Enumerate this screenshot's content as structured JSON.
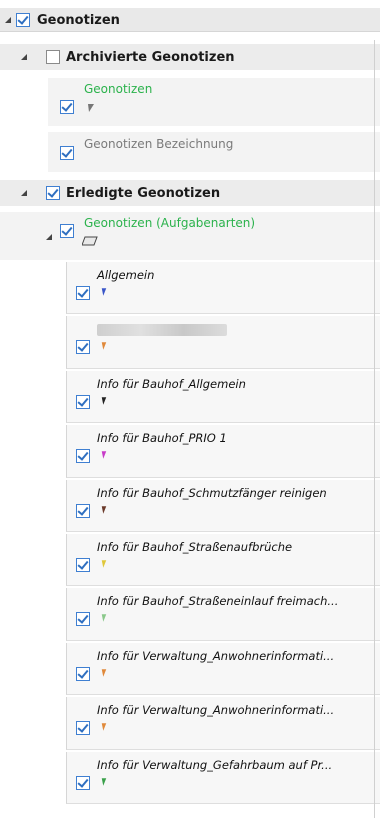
{
  "tree": {
    "root": {
      "label": "Geonotizen"
    },
    "archived": {
      "label": "Archivierte Geonotizen"
    },
    "archived_children": [
      {
        "label": "Geonotizen"
      },
      {
        "label": "Geonotizen Bezeichnung"
      }
    ],
    "done": {
      "label": "Erledigte Geonotizen"
    },
    "done_group": {
      "label": "Geonotizen (Aufgabenarten)"
    },
    "items": [
      {
        "label": "Allgemein",
        "color": "#3a56c8"
      },
      {
        "label": "",
        "color": "#e0893a"
      },
      {
        "label": "Info für Bauhof_Allgemein",
        "color": "#222222"
      },
      {
        "label": "Info für Bauhof_PRIO 1",
        "color": "#c83ac8"
      },
      {
        "label": "Info für Bauhof_Schmutzfänger reinigen",
        "color": "#6b3a2a"
      },
      {
        "label": "Info für Bauhof_Straßenaufbrüche",
        "color": "#e0c83a"
      },
      {
        "label": "Info für Bauhof_Straßeneinlauf freimach...",
        "color": "#8ac88a"
      },
      {
        "label": "Info für Verwaltung_Anwohnerinformati...",
        "color": "#e0893a"
      },
      {
        "label": "Info für Verwaltung_Anwohnerinformati...",
        "color": "#e0893a"
      },
      {
        "label": "Info für Verwaltung_Gefahrbaum auf Pr...",
        "color": "#3aa04a"
      }
    ]
  }
}
